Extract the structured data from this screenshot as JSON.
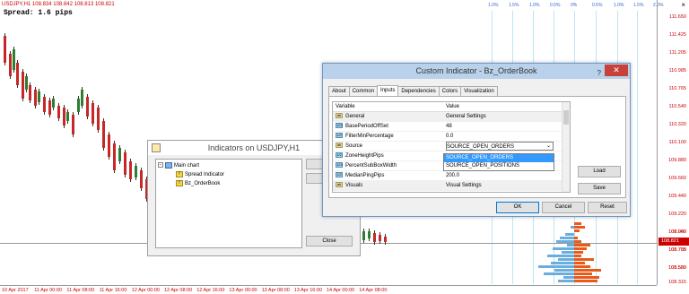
{
  "chart": {
    "title": "USDJPY,H1  108.834 108.842 108.813 108.821",
    "spread": "Spread: 1.6 pips",
    "close_glyph": "×",
    "percent_scale": [
      "1.0%",
      "1.5%",
      "1.0%",
      "0.5%",
      "0%",
      "0.5%",
      "1.0%",
      "1.5%",
      "2.0%"
    ],
    "price_labels": [
      "111.650",
      "111.425",
      "111.205",
      "110.985",
      "110.765",
      "110.540",
      "110.320",
      "110.100",
      "109.880",
      "109.660",
      "109.440",
      "109.220",
      "109.000",
      "108.780",
      "108.560",
      "108.940",
      "108.735",
      "108.530",
      "108.315"
    ],
    "current_price": "108.821",
    "time_labels": [
      "10 Apr 2017",
      "11 Apr 00:00",
      "11 Apr 08:00",
      "11 Apr 16:00",
      "12 Apr 00:00",
      "12 Apr 08:00",
      "12 Apr 16:00",
      "13 Apr 00:00",
      "13 Apr 08:00",
      "13 Apr 16:00",
      "14 Apr 00:00",
      "14 Apr 08:00"
    ],
    "colors": {
      "up": "#2e7d32",
      "down": "#c62828",
      "ask": "#e85a1a",
      "bid": "#6aaee0"
    }
  },
  "indicators_window": {
    "title": "Indicators on USDJPY,H1",
    "tree": [
      {
        "label": "Main chart",
        "expander": "−",
        "type": "main"
      },
      {
        "label": "Spread Indicator",
        "type": "f"
      },
      {
        "label": "Bz_OrderBook",
        "type": "f"
      }
    ],
    "icon_letter": "f",
    "close_label": "Close"
  },
  "dialog": {
    "title": "Custom Indicator - Bz_OrderBook",
    "help": "?",
    "close": "✕",
    "tabs": [
      "About",
      "Common",
      "Inputs",
      "Dependencies",
      "Colors",
      "Visualization"
    ],
    "active_tab": "Inputs",
    "grid_headers": [
      "Variable",
      "Value"
    ],
    "rows": [
      {
        "icon": "ab",
        "variable": "General",
        "value": "General Settings"
      },
      {
        "icon": "123",
        "variable": "BasePeriodOffSet",
        "value": "48"
      },
      {
        "icon": "1/2",
        "variable": "FilterMinPercentage",
        "value": "0.0"
      },
      {
        "icon": "ab",
        "variable": "Source",
        "value": "SOURCE_OPEN_ORDERS"
      },
      {
        "icon": "1/2",
        "variable": "ZoneHeightPips",
        "value": ""
      },
      {
        "icon": "123",
        "variable": "PercentSubBoxWidth",
        "value": ""
      },
      {
        "icon": "1/2",
        "variable": "MedianPingPips",
        "value": "200.0"
      },
      {
        "icon": "ab",
        "variable": "Visuals",
        "value": "Visual Settings"
      }
    ],
    "dropdown_options": [
      "SOURCE_OPEN_ORDERS",
      "SOURCE_OPEN_POSITIONS"
    ],
    "load_label": "Load",
    "save_label": "Save",
    "ok_label": "OK",
    "cancel_label": "Cancel",
    "reset_label": "Reset"
  }
}
